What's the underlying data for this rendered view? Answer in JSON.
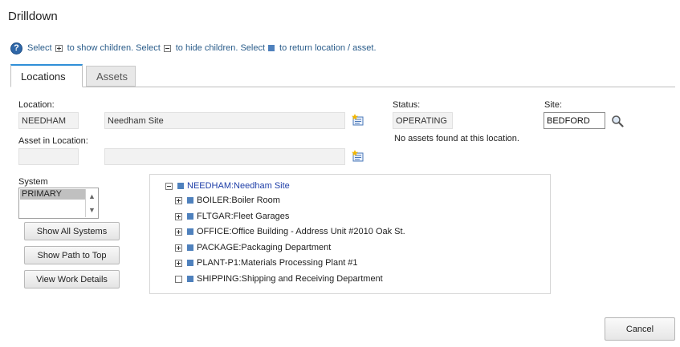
{
  "window": {
    "title": "Drilldown"
  },
  "hint": {
    "select1": "Select",
    "show_children": "to show children. Select",
    "hide_children": "to hide children. Select",
    "return": "to return location / asset."
  },
  "tabs": [
    {
      "label": "Locations",
      "active": true
    },
    {
      "label": "Assets",
      "active": false
    }
  ],
  "form": {
    "location_label": "Location:",
    "location_code": "NEEDHAM",
    "location_desc": "Needham Site",
    "asset_label": "Asset in Location:",
    "asset_code": "",
    "asset_desc": "",
    "status_label": "Status:",
    "status_value": "OPERATING",
    "no_assets_msg": "No assets found at this location.",
    "site_label": "Site:",
    "site_value": "BEDFORD",
    "system_label": "System",
    "system_selected": "PRIMARY"
  },
  "buttons": {
    "show_all_systems": "Show All Systems",
    "show_path_to_top": "Show Path to Top",
    "view_work_details": "View Work Details",
    "cancel": "Cancel"
  },
  "tree": {
    "root": "NEEDHAM:Needham Site",
    "children": [
      "BOILER:Boiler Room",
      "FLTGAR:Fleet Garages",
      "OFFICE:Office Building - Address Unit #2010 Oak St.",
      "PACKAGE:Packaging Department",
      "PLANT-P1:Materials Processing Plant #1",
      "SHIPPING:Shipping and Receiving Department"
    ]
  },
  "colors": {
    "accent": "#2f8fd8",
    "node_icon": "#4f81bd",
    "link": "#2a5c8a"
  }
}
